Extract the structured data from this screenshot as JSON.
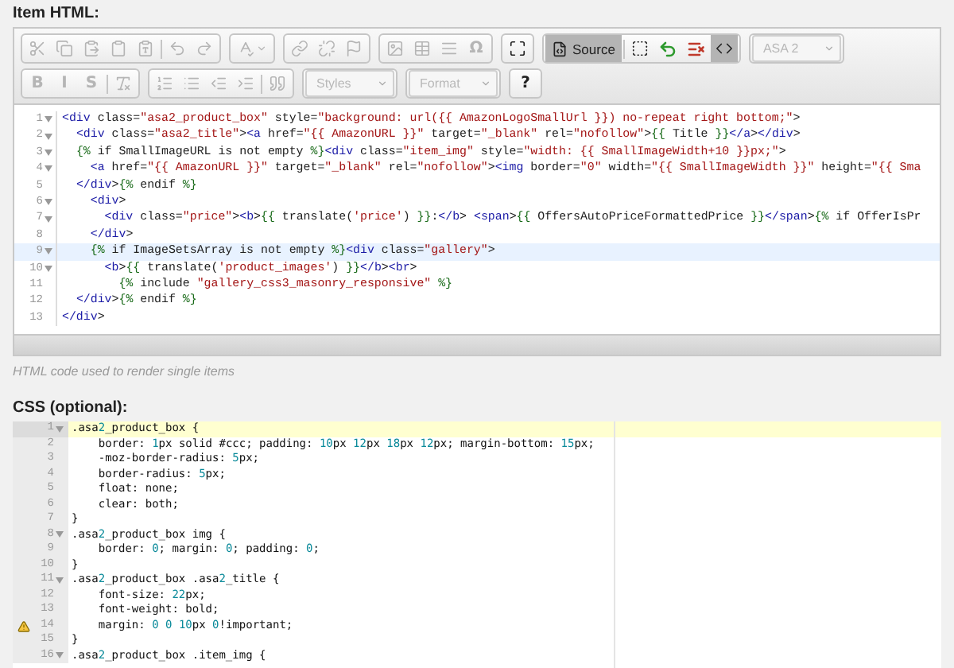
{
  "html_section": {
    "label": "Item HTML:",
    "toolbar": {
      "rows": [
        [
          {
            "items": [
              {
                "kind": "icon",
                "disabled": true
              },
              {
                "kind": "icon",
                "disabled": true
              },
              {
                "kind": "icon",
                "disabled": true
              },
              {
                "kind": "icon",
                "disabled": true
              },
              {
                "kind": "icon",
                "disabled": true
              },
              {
                "kind": "separator"
              },
              {
                "kind": "icon",
                "disabled": true
              },
              {
                "kind": "icon",
                "disabled": true
              }
            ]
          },
          {
            "items": [
              {
                "kind": "icon-menu",
                "disabled": true
              }
            ]
          },
          {
            "items": [
              {
                "kind": "icon",
                "disabled": true
              },
              {
                "kind": "icon",
                "disabled": true
              },
              {
                "kind": "icon",
                "disabled": true
              }
            ]
          },
          {
            "items": [
              {
                "kind": "icon",
                "disabled": true
              },
              {
                "kind": "icon",
                "disabled": true
              },
              {
                "kind": "icon",
                "disabled": true
              },
              {
                "kind": "glyph",
                "label": "Ω",
                "disabled": true
              }
            ]
          },
          {
            "items": [
              {
                "kind": "icon",
                "disabled": false
              }
            ]
          },
          {
            "items": [
              {
                "kind": "text-button",
                "label": "Source",
                "disabled": false,
                "on": true
              },
              {
                "kind": "separator"
              },
              {
                "kind": "icon",
                "disabled": false,
                "on": false
              },
              {
                "kind": "icon",
                "disabled": false,
                "on": false,
                "color": "#2e9a2e"
              },
              {
                "kind": "icon",
                "disabled": false,
                "on": false,
                "color": "#c0392b"
              },
              {
                "kind": "icon",
                "disabled": false,
                "on": true
              }
            ]
          },
          {
            "items": [
              {
                "kind": "dropdown",
                "label": "ASA 2",
                "disabled": true
              }
            ]
          }
        ],
        [
          {
            "items": [
              {
                "kind": "glyph",
                "label": "B",
                "disabled": true
              },
              {
                "kind": "glyph",
                "label": "I",
                "disabled": true
              },
              {
                "kind": "glyph",
                "label": "S",
                "disabled": true
              },
              {
                "kind": "separator"
              },
              {
                "kind": "icon",
                "disabled": true
              }
            ]
          },
          {
            "items": [
              {
                "kind": "icon",
                "disabled": true
              },
              {
                "kind": "icon",
                "disabled": true
              },
              {
                "kind": "icon",
                "disabled": true
              },
              {
                "kind": "icon",
                "disabled": true
              },
              {
                "kind": "separator"
              },
              {
                "kind": "icon",
                "disabled": true
              }
            ]
          },
          {
            "items": [
              {
                "kind": "dropdown",
                "label": "Styles",
                "disabled": true
              }
            ]
          },
          {
            "items": [
              {
                "kind": "dropdown",
                "label": "Format",
                "disabled": true
              }
            ]
          },
          {
            "items": [
              {
                "kind": "glyph",
                "label": "?",
                "disabled": false
              }
            ]
          }
        ]
      ]
    },
    "editor": {
      "lines": [
        {
          "number": "1",
          "foldable": true,
          "active": false,
          "text": "<div class=\"asa2_product_box\" style=\"background: url({{ AmazonLogoSmallUrl }}) no-repeat right bottom;\">"
        },
        {
          "number": "2",
          "foldable": true,
          "active": false,
          "text": "  <div class=\"asa2_title\"><a href=\"{{ AmazonURL }}\" target=\"_blank\" rel=\"nofollow\">{{ Title }}</a></div>"
        },
        {
          "number": "3",
          "foldable": true,
          "active": false,
          "text": "  {% if SmallImageURL is not empty %}<div class=\"item_img\" style=\"width: {{ SmallImageWidth+10 }}px;\">"
        },
        {
          "number": "4",
          "foldable": true,
          "active": false,
          "text": "    <a href=\"{{ AmazonURL }}\" target=\"_blank\" rel=\"nofollow\"><img border=\"0\" width=\"{{ SmallImageWidth }}\" height=\"{{ Sma"
        },
        {
          "number": "5",
          "foldable": false,
          "active": false,
          "text": "  </div>{% endif %}"
        },
        {
          "number": "6",
          "foldable": true,
          "active": false,
          "text": "    <div>"
        },
        {
          "number": "7",
          "foldable": true,
          "active": false,
          "text": "      <div class=\"price\"><b>{{ translate('price') }}:</b> <span>{{ OffersAutoPriceFormattedPrice }}</span>{% if OfferIsPr"
        },
        {
          "number": "8",
          "foldable": false,
          "active": false,
          "text": "    </div>"
        },
        {
          "number": "9",
          "foldable": true,
          "active": true,
          "text": "    {% if ImageSetsArray is not empty %}<div class=\"gallery\">"
        },
        {
          "number": "10",
          "foldable": true,
          "active": false,
          "text": "      <b>{{ translate('product_images') }}</b><br>"
        },
        {
          "number": "11",
          "foldable": false,
          "active": false,
          "text": "        {% include \"gallery_css3_masonry_responsive\" %}"
        },
        {
          "number": "12",
          "foldable": false,
          "active": false,
          "text": "  </div>{% endif %}"
        },
        {
          "number": "13",
          "foldable": false,
          "active": false,
          "text": "</div>"
        }
      ]
    },
    "hint": "HTML code used to render single items"
  },
  "css_section": {
    "label": "CSS (optional):",
    "editor": {
      "lines": [
        {
          "number": "1",
          "foldable": true,
          "active": true,
          "warning": false,
          "text": ".asa2_product_box {"
        },
        {
          "number": "2",
          "foldable": false,
          "active": false,
          "warning": false,
          "text": "    border: 1px solid #ccc; padding: 10px 12px 18px 12px; margin-bottom: 15px;"
        },
        {
          "number": "3",
          "foldable": false,
          "active": false,
          "warning": false,
          "text": "    -moz-border-radius: 5px;"
        },
        {
          "number": "4",
          "foldable": false,
          "active": false,
          "warning": false,
          "text": "    border-radius: 5px;"
        },
        {
          "number": "5",
          "foldable": false,
          "active": false,
          "warning": false,
          "text": "    float: none;"
        },
        {
          "number": "6",
          "foldable": false,
          "active": false,
          "warning": false,
          "text": "    clear: both;"
        },
        {
          "number": "7",
          "foldable": false,
          "active": false,
          "warning": false,
          "text": "}"
        },
        {
          "number": "8",
          "foldable": true,
          "active": false,
          "warning": false,
          "text": ".asa2_product_box img {"
        },
        {
          "number": "9",
          "foldable": false,
          "active": false,
          "warning": false,
          "text": "    border: 0; margin: 0; padding: 0;"
        },
        {
          "number": "10",
          "foldable": false,
          "active": false,
          "warning": false,
          "text": "}"
        },
        {
          "number": "11",
          "foldable": true,
          "active": false,
          "warning": false,
          "text": ".asa2_product_box .asa2_title {"
        },
        {
          "number": "12",
          "foldable": false,
          "active": false,
          "warning": false,
          "text": "    font-size: 22px;"
        },
        {
          "number": "13",
          "foldable": false,
          "active": false,
          "warning": false,
          "text": "    font-weight: bold;"
        },
        {
          "number": "14",
          "foldable": false,
          "active": false,
          "warning": true,
          "text": "    margin: 0 0 10px 0!important;"
        },
        {
          "number": "15",
          "foldable": false,
          "active": false,
          "warning": false,
          "text": "}"
        },
        {
          "number": "16",
          "foldable": true,
          "active": false,
          "warning": false,
          "text": ".asa2_product_box .item_img {"
        }
      ]
    }
  }
}
